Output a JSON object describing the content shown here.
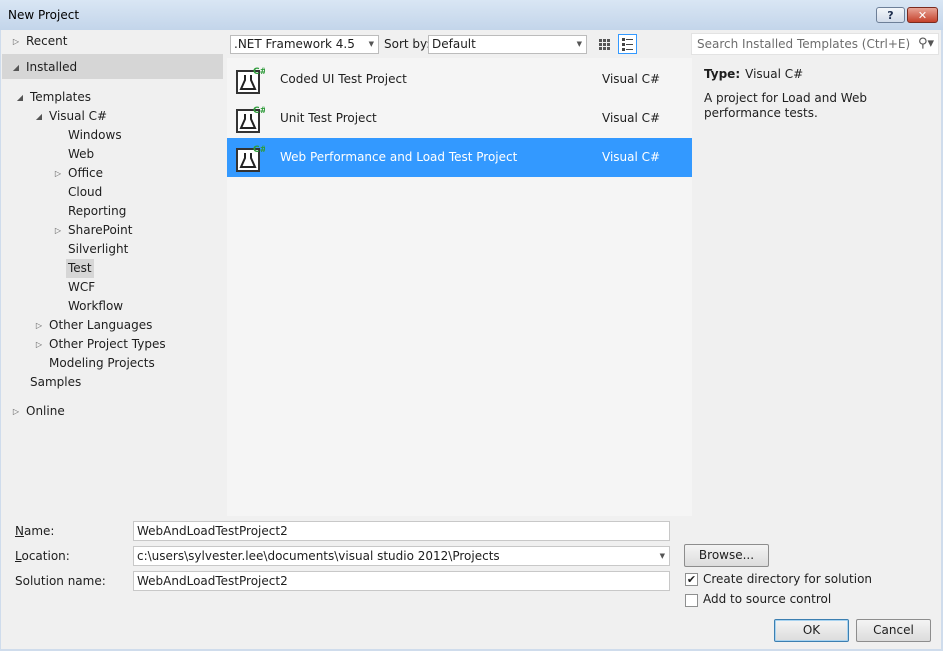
{
  "window": {
    "title": "New Project",
    "help_label": "?",
    "close_label": "✕"
  },
  "tree": {
    "recent": "Recent",
    "installed": "Installed",
    "templates": "Templates",
    "visual_csharp": "Visual C#",
    "windows": "Windows",
    "web": "Web",
    "office": "Office",
    "cloud": "Cloud",
    "reporting": "Reporting",
    "sharepoint": "SharePoint",
    "silverlight": "Silverlight",
    "test": "Test",
    "wcf": "WCF",
    "workflow": "Workflow",
    "other_languages": "Other Languages",
    "other_project_types": "Other Project Types",
    "modeling_projects": "Modeling Projects",
    "samples": "Samples",
    "online": "Online"
  },
  "toolbar": {
    "framework": ".NET Framework 4.5",
    "sort_by_label": "Sort by:",
    "sort_by_value": "Default",
    "search_placeholder": "Search Installed Templates (Ctrl+E)"
  },
  "templates": [
    {
      "name": "Coded UI Test Project",
      "language": "Visual C#",
      "selected": false
    },
    {
      "name": "Unit Test Project",
      "language": "Visual C#",
      "selected": false
    },
    {
      "name": "Web Performance and Load Test Project",
      "language": "Visual C#",
      "selected": true
    }
  ],
  "description": {
    "type_label": "Type:",
    "type_value": "Visual C#",
    "text": "A project for Load and Web performance tests."
  },
  "form": {
    "name_label": "Name:",
    "name_value": "WebAndLoadTestProject2",
    "location_label": "Location:",
    "location_value": "c:\\users\\sylvester.lee\\documents\\visual studio 2012\\Projects",
    "solution_label": "Solution name:",
    "solution_value": "WebAndLoadTestProject2",
    "browse_label": "Browse...",
    "create_dir_label": "Create directory for solution",
    "create_dir_checked": true,
    "source_control_label": "Add to source control",
    "source_control_checked": false,
    "ok_label": "OK",
    "cancel_label": "Cancel"
  },
  "colors": {
    "selection": "#3399ff",
    "accent_green": "#2e9b3a"
  }
}
